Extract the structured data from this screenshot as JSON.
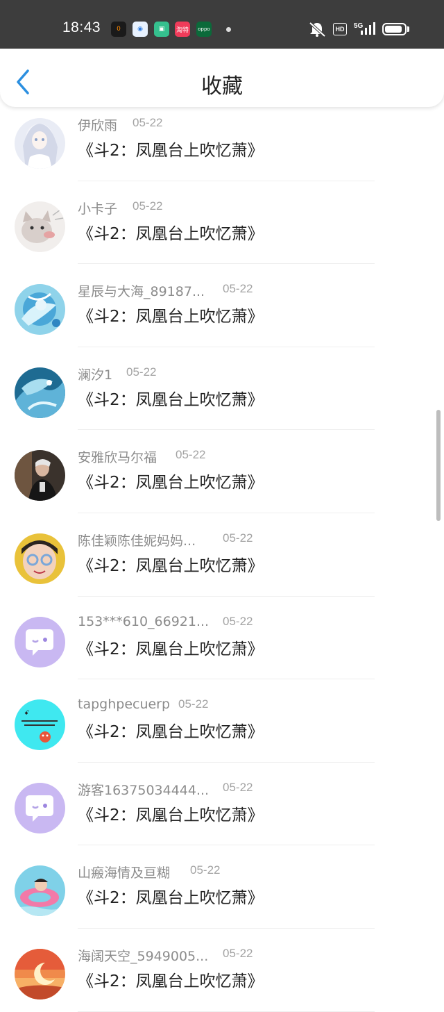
{
  "status_bar": {
    "time": "18:43",
    "apps": [
      {
        "name": "app-orange-icon",
        "label": "0",
        "bg": "#1a1a1a",
        "fg": "#ff8a00"
      },
      {
        "name": "app-blue-icon",
        "label": "◉",
        "bg": "#e8f2ff",
        "fg": "#2f7de1"
      },
      {
        "name": "app-green-icon",
        "label": "▣",
        "bg": "#35c08e",
        "fg": "#ffffff"
      },
      {
        "name": "app-red-icon",
        "label": "淘特",
        "bg": "#f03b5a",
        "fg": "#ffffff"
      },
      {
        "name": "app-oppo-icon",
        "label": "oppo",
        "bg": "#0b6a3a",
        "fg": "#ffffff"
      }
    ],
    "hd": "HD",
    "net": "5G",
    "battery_level": 0.88
  },
  "header": {
    "title": "收藏",
    "back_icon": "chevron-left-icon"
  },
  "colors": {
    "accent": "#2b8fe0",
    "text_primary": "#222222",
    "text_secondary": "#8c8c8c",
    "divider": "#eeeeee"
  },
  "items": [
    {
      "name": "伊欣雨",
      "date": "05-22",
      "message": "《斗2：凤凰台上吹忆萧》",
      "avatar": "anime-girl"
    },
    {
      "name": "小卡子",
      "date": "05-22",
      "message": "《斗2：凤凰台上吹忆萧》",
      "avatar": "cat"
    },
    {
      "name": "星辰与大海_89187...",
      "date": "05-22",
      "message": "《斗2：凤凰台上吹忆萧》",
      "avatar": "blue-splash"
    },
    {
      "name": "澜汐1",
      "date": "05-22",
      "message": "《斗2：凤凰台上吹忆萧》",
      "avatar": "ice-dragon"
    },
    {
      "name": "安雅欣马尔福",
      "date": "05-22",
      "message": "《斗2：凤凰台上吹忆萧》",
      "avatar": "dark-portrait"
    },
    {
      "name": "陈佳颖陈佳妮妈妈...",
      "date": "05-22",
      "message": "《斗2：凤凰台上吹忆萧》",
      "avatar": "child-glasses"
    },
    {
      "name": "153***610_66921...",
      "date": "05-22",
      "message": "《斗2：凤凰台上吹忆萧》",
      "avatar": "default-chat"
    },
    {
      "name": "tapghpecuerp",
      "date": "05-22",
      "message": "《斗2：凤凰台上吹忆萧》",
      "avatar": "cyan-note"
    },
    {
      "name": "游客16375034444...",
      "date": "05-22",
      "message": "《斗2：凤凰台上吹忆萧》",
      "avatar": "default-chat"
    },
    {
      "name": "山瘢海情及亘糊",
      "date": "05-22",
      "message": "《斗2：凤凰台上吹忆萧》",
      "avatar": "pool-float"
    },
    {
      "name": "海阔天空_5949005...",
      "date": "05-22",
      "message": "《斗2：凤凰台上吹忆萧》",
      "avatar": "sunset-moon"
    }
  ]
}
